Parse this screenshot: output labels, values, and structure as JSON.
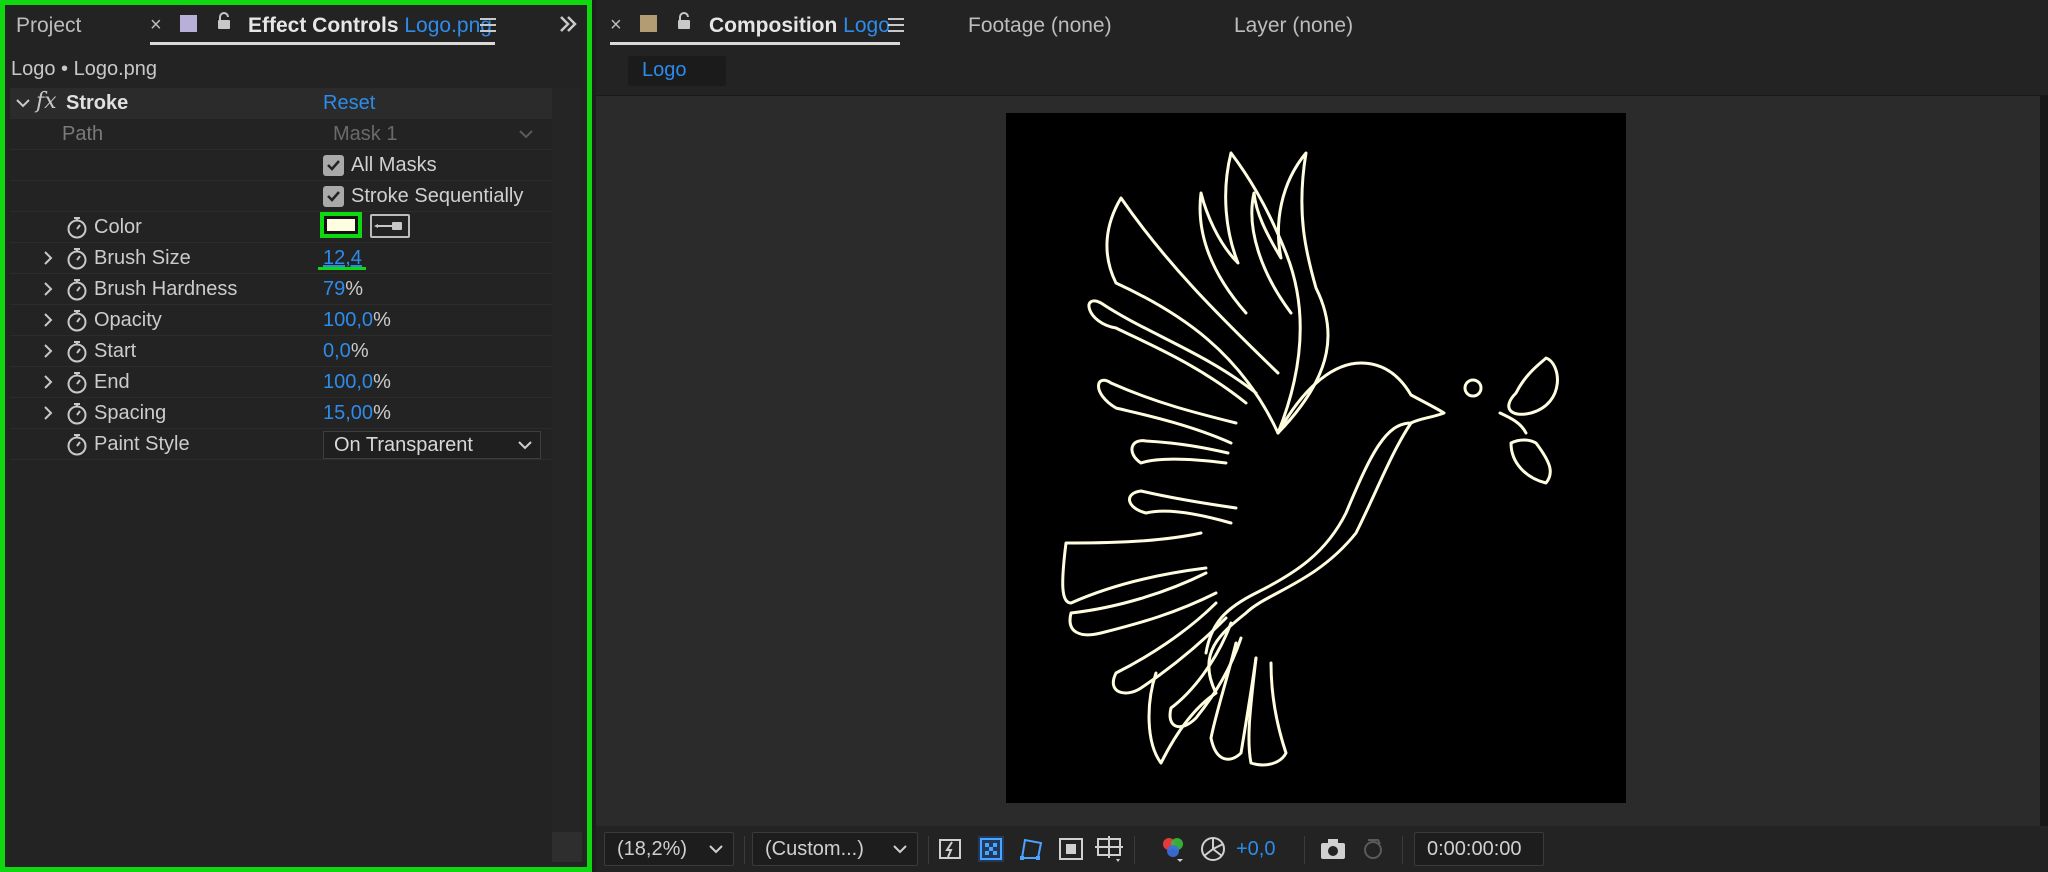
{
  "left_tabs": {
    "project": "Project",
    "effect_controls": "Effect Controls",
    "effect_file": "Logo.png",
    "panel_colors": {
      "effect_swatch": "#b8b0d8",
      "comp_swatch": "#b39b73",
      "accent_blue": "#2d8ceb",
      "highlight_green": "#10d810"
    }
  },
  "effect_title": "Logo • Logo.png",
  "effect": {
    "name": "Stroke",
    "reset": "Reset",
    "path_label": "Path",
    "path_value": "Mask 1",
    "all_masks": "All Masks",
    "stroke_sequentially": "Stroke Sequentially",
    "color_label": "Color",
    "color_value": "#fffde0",
    "brush_size_label": "Brush Size",
    "brush_size": "12,4",
    "brush_hardness_label": "Brush Hardness",
    "brush_hardness": "79",
    "opacity_label": "Opacity",
    "opacity": "100,0",
    "start_label": "Start",
    "start": "0,0",
    "end_label": "End",
    "end": "100,0",
    "spacing_label": "Spacing",
    "spacing": "15,00",
    "paint_style_label": "Paint Style",
    "paint_style": "On Transparent",
    "percent": "%"
  },
  "right_tabs": {
    "composition": "Composition",
    "comp_name": "Logo",
    "footage": "Footage (none)",
    "layer": "Layer (none)"
  },
  "viewer": {
    "comp_chip": "Logo",
    "zoom": "(18,2%)",
    "resolution": "(Custom...)",
    "exposure": "+0,0",
    "timecode": "0:00:00:00",
    "stroke_color": "#fffde0"
  }
}
